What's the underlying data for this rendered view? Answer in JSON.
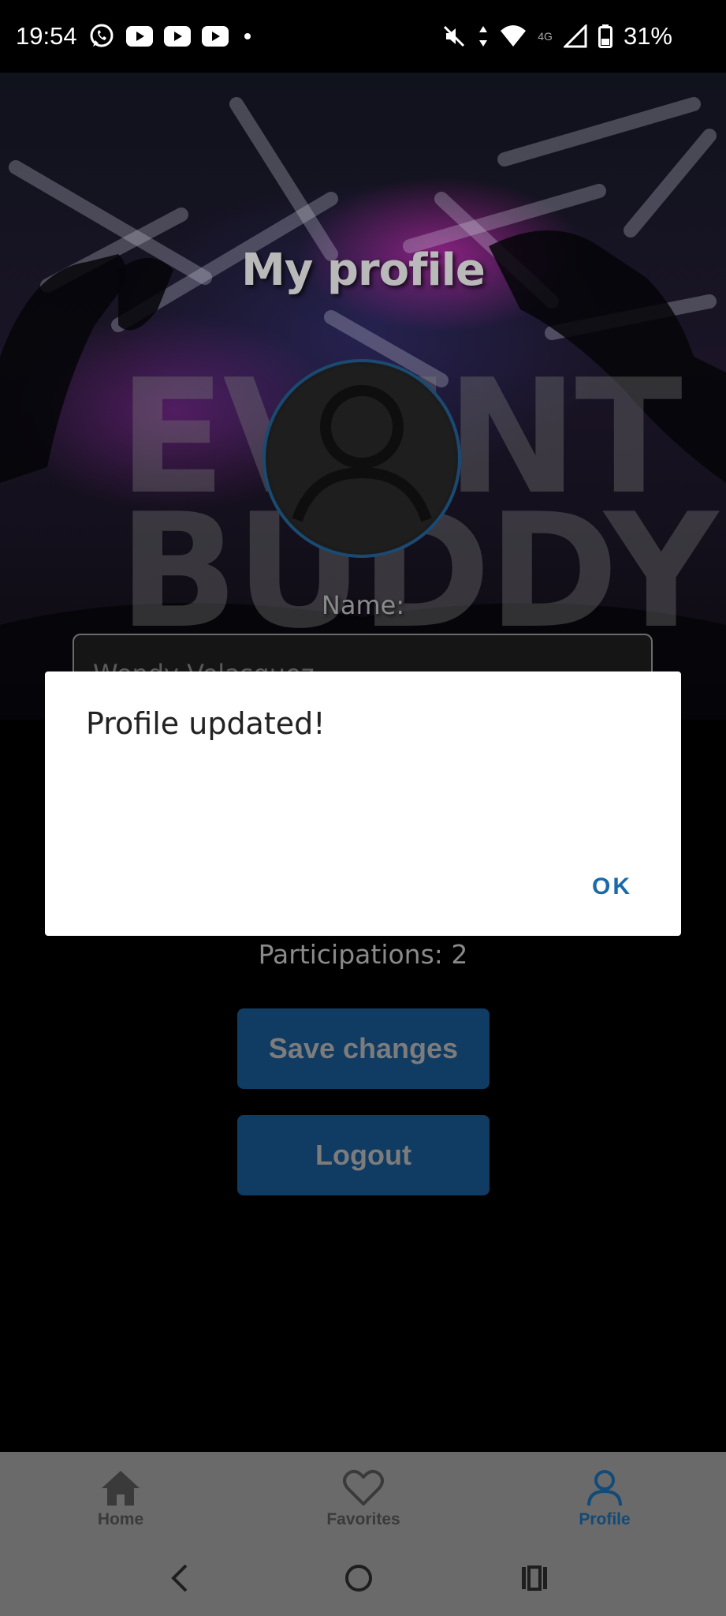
{
  "status_bar": {
    "time": "19:54",
    "battery": "31%",
    "network": "4G",
    "left_icons": [
      "whatsapp-icon",
      "youtube-icon",
      "youtube-icon",
      "youtube-icon",
      "dot-icon"
    ],
    "right_icons": [
      "mute-icon",
      "data-arrows-icon",
      "wifi-icon",
      "signal-icon",
      "battery-icon"
    ]
  },
  "page": {
    "title": "My profile",
    "logo_line1": "EVENT",
    "logo_line2": "BUDDY",
    "name_label": "Name:",
    "name_value": "Wendy Velasquez",
    "participations": "Participations: 2",
    "save_button": "Save changes",
    "logout_button": "Logout"
  },
  "dialog": {
    "message": "Profile updated!",
    "ok_button": "OK"
  },
  "bottom_nav": {
    "items": [
      {
        "label": "Home",
        "icon": "home-icon",
        "active": false
      },
      {
        "label": "Favorites",
        "icon": "heart-icon",
        "active": false
      },
      {
        "label": "Profile",
        "icon": "profile-icon",
        "active": true
      }
    ]
  },
  "system_nav": {
    "buttons": [
      "back-icon",
      "home-circle-icon",
      "recents-icon"
    ]
  },
  "colors": {
    "accent": "#1a6aa8",
    "button_bg": "#103b62",
    "nav_bg": "#6a6a6a",
    "dialog_bg": "#ffffff"
  }
}
